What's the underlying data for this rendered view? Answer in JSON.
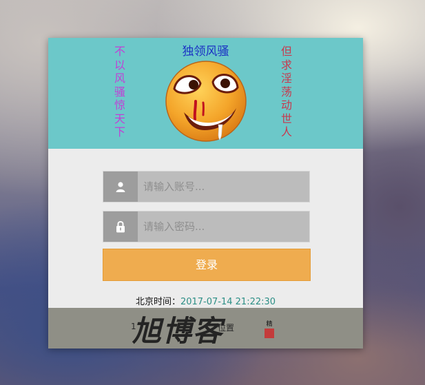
{
  "header": {
    "title": "独领风骚",
    "left_vertical": "不以风骚惊天下",
    "right_vertical": "但求淫荡动世人",
    "emoji_icon": "drooling-face-icon"
  },
  "login": {
    "username_placeholder": "请输入账号...",
    "password_placeholder": "请输入密码...",
    "username_icon": "user-icon",
    "password_icon": "lock-icon",
    "submit_label": "登录"
  },
  "clock": {
    "label": "北京时间：",
    "value": "2017-07-14 21:22:30"
  },
  "footer": {
    "brand": "旭博客",
    "left_small": "1",
    "right_small": "位置",
    "seal_text": "精",
    "seal_image": "red-seal-stamp"
  },
  "colors": {
    "header_bg": "#6cc8c9",
    "panel_bg": "#ececec",
    "button_bg": "#efac4f",
    "time_value": "#2d8f86",
    "title_blue": "#1b31c4",
    "left_magenta": "#c13fd6",
    "right_red": "#c8384d"
  }
}
